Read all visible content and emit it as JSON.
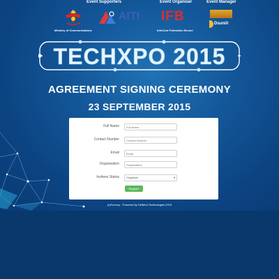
{
  "sponsors": {
    "event_supporters": "Event Supporters",
    "event_organiser": "Event Organiser",
    "event_manager": "Event Manager",
    "ministry_caption": "Ministry of Communications",
    "aiti_logo": "AITI",
    "ifb_logo": "IFB",
    "ifb_caption": "InfoCom Federation Brunei",
    "manager_logo": "Dsuniit"
  },
  "banner": {
    "logo_text": "TECHXPO 2015",
    "title": "AGREEMENT SIGNING CEREMONY",
    "date": "23 SEPTEMBER 2015"
  },
  "form": {
    "fields": [
      {
        "label": "Full Name",
        "placeholder": "Full Name"
      },
      {
        "label": "Contact Number",
        "placeholder": "Contact Number"
      },
      {
        "label": "Email",
        "placeholder": "Email"
      },
      {
        "label": "Organisation",
        "placeholder": "Organisation"
      }
    ],
    "status_label": "Invitees Status",
    "status_value": "Organiser",
    "register_label": "Register"
  },
  "footer": "(c)Formny - Powered by DelMod Technologies 2015",
  "colors": {
    "accent_green": "#5cb85c",
    "background": "#0b4282",
    "ifb_red": "#e32b2b"
  }
}
